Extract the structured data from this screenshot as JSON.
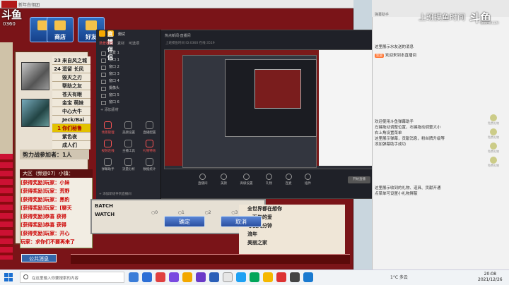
{
  "game": {
    "window_title": "新年白翎团",
    "douyu_logo": "斗鱼",
    "room_id": "0360",
    "top_buttons": [
      "",
      "商店",
      "好友"
    ],
    "ranking": [
      {
        "n": "23",
        "name": "来自风之城"
      },
      {
        "n": "24",
        "name": "逗留 长风"
      },
      {
        "n": "",
        "name": "毁灭之刃"
      },
      {
        "n": "",
        "name": "帮助之友"
      },
      {
        "n": "",
        "name": "苍天有眼"
      },
      {
        "n": "",
        "name": "金宝 萌妹"
      },
      {
        "n": "",
        "name": "中心大牛"
      },
      {
        "n": "",
        "name": "Jeck/Bai"
      },
      {
        "n": "1",
        "name": "你们秘鲁"
      },
      {
        "n": "",
        "name": "紫色夜"
      },
      {
        "n": "",
        "name": "成人们"
      }
    ],
    "power_label": "势力战参加者：1人",
    "chat_header": "大区（频道07）小镇：",
    "chat_lines": [
      "[获得奖励]玩家：小妹",
      "[获得奖励]玩家：荒野",
      "[获得奖励]玩家：黑豹",
      "[获得奖励]玩家：[聊天",
      "[获得奖励]恭喜 获得",
      "[获得奖励]恭喜 获得",
      "[获得奖励]玩家：开心",
      "玩家：求你们不要再来了"
    ],
    "public_msg_btn": "公共消息",
    "dialog": {
      "row1": "BATCH",
      "row2": "WATCH",
      "opts": [
        "○0",
        "○1",
        "○2",
        "○3",
        "○4"
      ],
      "ok": "确定",
      "cancel": "取消"
    },
    "right_list": [
      "全世界都在想你",
      "一万年的爱",
      "等我几分钟",
      "流年",
      "美丽之家"
    ]
  },
  "studio": {
    "title": "直播伴侣",
    "badge": "测试",
    "tabs": [
      "场景模式",
      "素材",
      "可选项"
    ],
    "scenes": [
      "场景 1",
      "窗口 1",
      "窗口 2",
      "窗口 3",
      "窗口 4",
      "摄像头",
      "窗口 5",
      "窗口 6",
      "窗口 7"
    ],
    "add_scene": "+ 添加素材",
    "tools": [
      "场景管理",
      "美颜设置",
      "直播配置",
      "视频连线",
      "主播工具",
      "礼物特效",
      "弹幕助手",
      "流量分析",
      "数据统计"
    ],
    "footer": "+ 添加新组件到直播间",
    "head_title": "热点新闻·直播间",
    "head_sub": "上班摸鱼时间 ID:0360 在线:3519",
    "bottom_tools": [
      "直播间",
      "美颜",
      "高级设置",
      "礼物",
      "连麦",
      "插件"
    ],
    "start_btn": "开始直播"
  },
  "danmaku": {
    "panel_title": "弹幕助手",
    "banner": "上班摸鱼时间",
    "watermark": "斗鱼",
    "watermark_sub": "DOUYU.COM",
    "messages": [
      {
        "tag": "",
        "text": "这里展示水友送的消息"
      },
      {
        "tag": "欢迎",
        "text": "欢迎来到本直播间"
      },
      {
        "tag": "",
        "text": "欢迎使用斗鱼弹幕助手"
      },
      {
        "tag": "",
        "text": "左键拖动调整位置，右键拖动调整大小"
      },
      {
        "tag": "",
        "text": "右上角设置菜单"
      },
      {
        "tag": "",
        "text": "这里展示弹幕，贡献消息，粉丝牌升级等"
      },
      {
        "tag": "",
        "text": "添加弹幕助手成功"
      },
      {
        "tag": "",
        "text": "这里展示收到的礼物、道具、贡献开通"
      },
      {
        "tag": "",
        "text": "点菜单可设置小礼物屏蔽"
      }
    ],
    "gifts": [
      "免费礼物",
      "免费礼物",
      "免费礼物",
      "免费礼物"
    ]
  },
  "taskbar": {
    "search_placeholder": "在这里输入你要搜索的内容",
    "weather": "1°C 多云",
    "time": "20:08",
    "date": "2021/12/26"
  }
}
